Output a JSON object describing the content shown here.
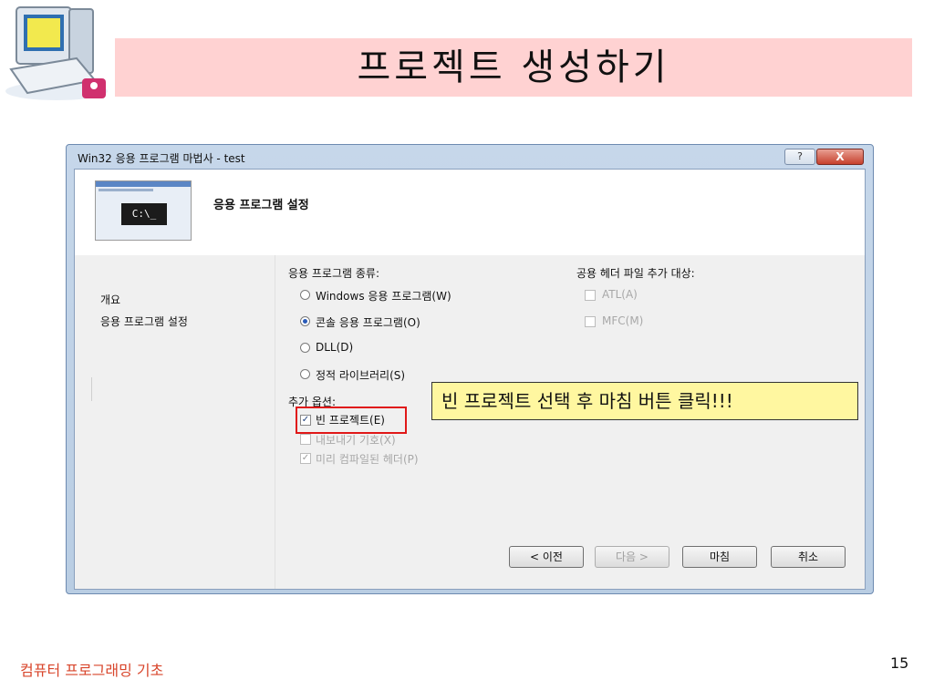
{
  "slide": {
    "title": "프로젝트 생성하기",
    "footer": "컴퓨터 프로그래밍 기초",
    "page_number": "15"
  },
  "window": {
    "title": "Win32 응용 프로그램 마법사 - test",
    "help_label": "?",
    "close_label": "X",
    "header_title": "응용 프로그램 설정",
    "thumb_console": "C:\\_"
  },
  "nav": {
    "items": [
      {
        "label": "개요"
      },
      {
        "label": "응용 프로그램 설정"
      }
    ]
  },
  "app_type": {
    "label": "응용 프로그램 종류:",
    "options": [
      {
        "label": "Windows 응용 프로그램(W)",
        "selected": false
      },
      {
        "label": "콘솔 응용 프로그램(O)",
        "selected": true
      },
      {
        "label": "DLL(D)",
        "selected": false
      },
      {
        "label": "정적 라이브러리(S)",
        "selected": false
      }
    ]
  },
  "headers": {
    "label": "공용 헤더 파일 추가 대상:",
    "options": [
      {
        "label": "ATL(A)",
        "checked": false
      },
      {
        "label": "MFC(M)",
        "checked": false
      }
    ]
  },
  "extra": {
    "label": "추가 옵션:",
    "options": [
      {
        "label": "빈 프로젝트(E)",
        "checked": true
      },
      {
        "label": "내보내기 기호(X)",
        "checked": false
      },
      {
        "label": "미리 컴파일된 헤더(P)",
        "checked": true
      }
    ]
  },
  "buttons": {
    "prev": "< 이전",
    "next": "다음 >",
    "finish": "마침",
    "cancel": "취소"
  },
  "callout": "빈 프로젝트 선택 후 마침 버튼 클릭!!!",
  "colors": {
    "title_band": "#ffd2d2",
    "highlight": "#e01818",
    "callout_bg": "#fff7a0",
    "footer": "#d8452b"
  }
}
